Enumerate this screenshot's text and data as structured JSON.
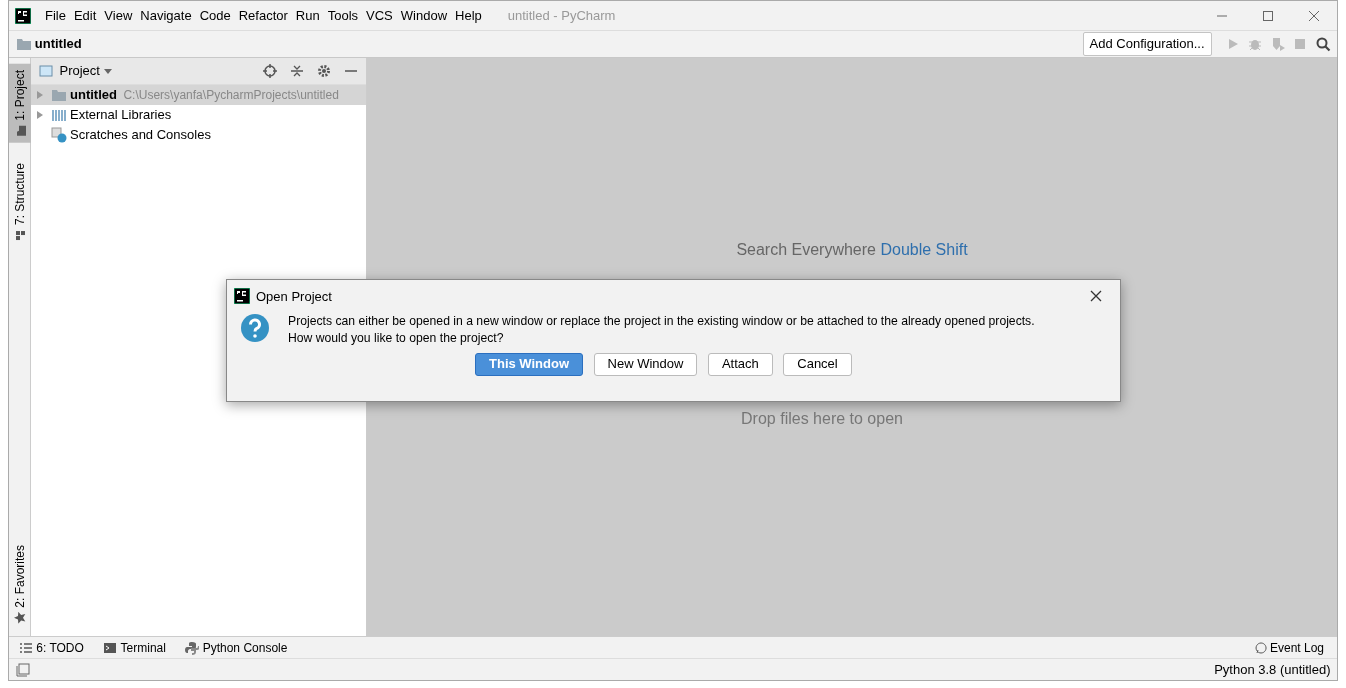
{
  "window": {
    "title": "untitled - PyCharm"
  },
  "menu": [
    "File",
    "Edit",
    "View",
    "Navigate",
    "Code",
    "Refactor",
    "Run",
    "Tools",
    "VCS",
    "Window",
    "Help"
  ],
  "navbar": {
    "breadcrumb": "untitled",
    "run_config": "Add Configuration..."
  },
  "left_stripe": [
    {
      "label": "1: Project",
      "selected": true,
      "kind": "folder"
    },
    {
      "label": "7: Structure",
      "selected": false,
      "kind": "structure"
    }
  ],
  "left_stripe_bottom": [
    {
      "label": "2: Favorites",
      "selected": false,
      "kind": "star"
    }
  ],
  "project_panel": {
    "title": "Project",
    "tree": [
      {
        "label": "untitled",
        "path": "C:\\Users\\yanfa\\PycharmProjects\\untitled",
        "kind": "folder",
        "expandable": true,
        "selected": true
      },
      {
        "label": "External Libraries",
        "kind": "library",
        "expandable": true,
        "selected": false
      },
      {
        "label": "Scratches and Consoles",
        "kind": "scratch",
        "expandable": false,
        "selected": false
      }
    ]
  },
  "editor": {
    "hint": "Search Everywhere",
    "shortcut": "Double Shift",
    "drop_hint": "Drop files here to open"
  },
  "dialog": {
    "title": "Open Project",
    "message": [
      "Projects can either be opened in a new window or replace the project in the existing window or be attached to the already opened projects.",
      "How would you like to open the project?"
    ],
    "buttons": [
      {
        "label": "This Window",
        "default": true
      },
      {
        "label": "New Window",
        "default": false
      },
      {
        "label": "Attach",
        "default": false
      },
      {
        "label": "Cancel",
        "default": false
      }
    ]
  },
  "bottom_tools": [
    {
      "label": "6: TODO",
      "kind": "list"
    },
    {
      "label": "Terminal",
      "kind": "terminal"
    },
    {
      "label": "Python Console",
      "kind": "python"
    }
  ],
  "event_log": "Event Log",
  "status_bar": {
    "interpreter": "Python 3.8 (untitled)"
  }
}
